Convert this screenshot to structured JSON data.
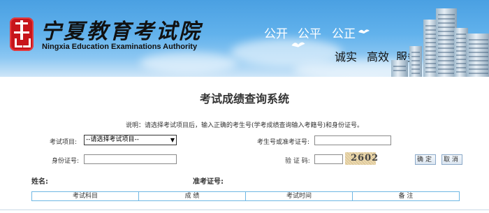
{
  "header": {
    "title_cn": "宁夏教育考试院",
    "title_en": "Ningxia Education Examinations Authority",
    "slogans_top": [
      "公开",
      "公平",
      "公正"
    ],
    "slogans_bottom": [
      "诚实",
      "高效",
      "服务"
    ]
  },
  "page_title": "考试成绩查询系统",
  "instruction": "说明：请选择考试项目后，输入正确的考生号(学考成绩查询输入考籍号)和身份证号。",
  "form": {
    "exam_item_label": "考试项目:",
    "exam_item_selected": "--请选择考试项目--",
    "candidate_no_label": "考生号或准考证号:",
    "id_card_label": "身份证号:",
    "captcha_label": "验 证 码:",
    "captcha_text": "2602",
    "confirm_button": "确定",
    "cancel_button": "取消"
  },
  "result": {
    "name_label": "姓名:",
    "ticket_label": "准考证号:",
    "columns": [
      "考试科目",
      "成 绩",
      "考试时间",
      "备 注"
    ]
  },
  "colors": {
    "banner_blue": "#4aa0e2",
    "seal_red": "#c8151b",
    "table_border": "#6fb7e3"
  }
}
